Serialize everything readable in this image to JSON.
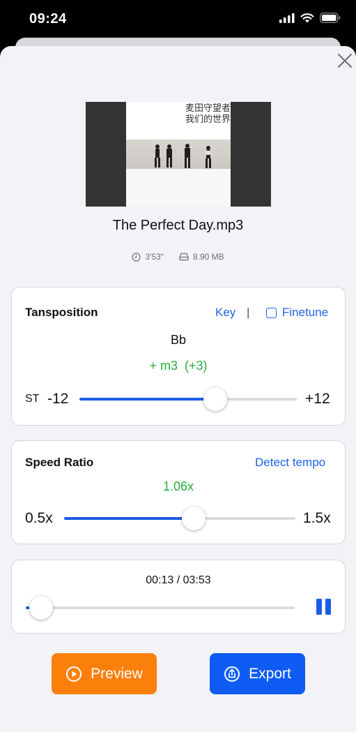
{
  "status_bar": {
    "time": "09:24"
  },
  "media": {
    "cover_line1": "麦田守望者",
    "cover_line2": "我们的世界",
    "title": "The Perfect Day.mp3",
    "duration": "3'53\"",
    "size": "8.90 MB"
  },
  "transposition": {
    "title": "Tansposition",
    "key_link": "Key",
    "divider": "|",
    "finetune_label": "Finetune",
    "finetune_checked": false,
    "key_value": "Bb",
    "interval": "+ m3  (+3)",
    "unit_label": "ST",
    "min_label": "-12",
    "max_label": "+12",
    "min": -12,
    "max": 12,
    "value": 3
  },
  "speed": {
    "title": "Speed Ratio",
    "detect_link": "Detect tempo",
    "value_label": "1.06x",
    "min_label": "0.5x",
    "max_label": "1.5x",
    "min": 0.5,
    "max": 1.5,
    "value": 1.06
  },
  "player": {
    "time_display": "00:13 / 03:53",
    "position_fraction": 0.056,
    "pause_icon": "pause-icon"
  },
  "actions": {
    "preview_label": "Preview",
    "export_label": "Export",
    "preview_color": "#fb7f0b",
    "export_color": "#0f5cf5"
  },
  "colors": {
    "accent_blue": "#1d63e6",
    "slider_fill": "#1a5ce6",
    "positive_green": "#22b03a"
  }
}
